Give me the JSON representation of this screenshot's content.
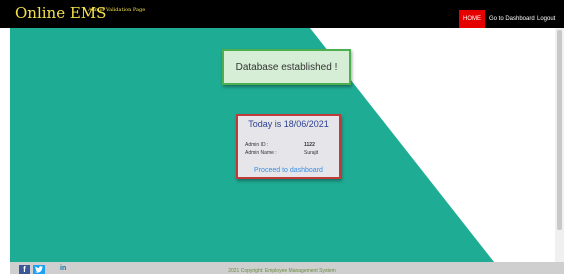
{
  "header": {
    "brand": "Online EMS",
    "subtitle": "Admin Validation Page",
    "nav": {
      "home": "HOME",
      "dashboard": "Go to Dashboard",
      "logout": "Logout"
    }
  },
  "alert": {
    "message": "Database established !"
  },
  "card": {
    "title": "Today is 18/06/2021",
    "admin_id_label": "Admin ID :",
    "admin_id_value": "1122",
    "admin_name_label": "Admin Name :",
    "admin_name_value": "Surajit",
    "proceed_link": "Proceed to dashboard"
  },
  "footer": {
    "copyright": "2021 Copyright: Employee Management System",
    "social_icons": [
      "facebook-icon",
      "twitter-icon",
      "linkedin-icon"
    ]
  },
  "colors": {
    "teal": "#1fac94",
    "header_bg": "#000000",
    "brand": "#f4e04d",
    "home_button": "#e40000",
    "alert_border": "#4caf50",
    "card_border": "#c23b3b"
  }
}
